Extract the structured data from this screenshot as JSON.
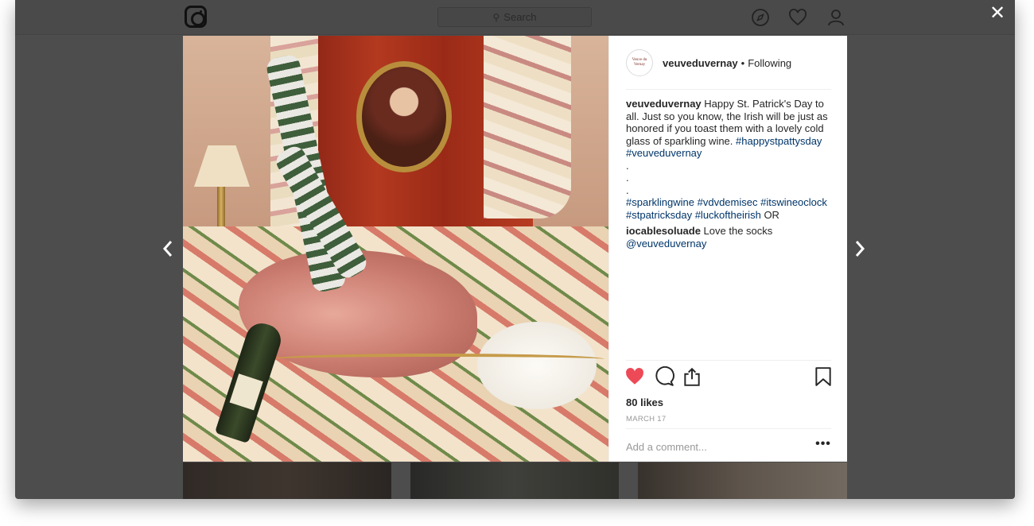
{
  "header": {
    "search_placeholder": "Search",
    "icons": [
      "instagram-logo-icon",
      "compass-icon",
      "heart-icon",
      "user-icon"
    ]
  },
  "overlay": {
    "close_glyph": "✕"
  },
  "post": {
    "username": "veuveduvernay",
    "separator": "•",
    "follow_status": "Following",
    "avatar_text": "Veuve du Vernay",
    "caption": {
      "username": "veuveduvernay",
      "text": "Happy St. Patrick's Day to all. Just so you know, the Irish will be just as honored if you toast them with a lovely cold glass of sparkling wine.",
      "tags_line1": "#happystpattysday",
      "tags_line2": "#veuveduvernay",
      "dots": [
        ".",
        ".",
        "."
      ],
      "tags_line3": "#sparklingwine #vdvdemisec #itswineoclock",
      "tags_line4": "#stpatricksday #luckoftheirish",
      "tail": "OR"
    },
    "comment": {
      "username": "iocablesoluade",
      "text": "Love the socks",
      "mention": "@veuveduvernay"
    },
    "likes_count": "80",
    "likes_label": "likes",
    "date": "MARCH 17",
    "comment_placeholder": "Add a comment...",
    "more_glyph": "•••",
    "like_color": "#ed4956"
  }
}
